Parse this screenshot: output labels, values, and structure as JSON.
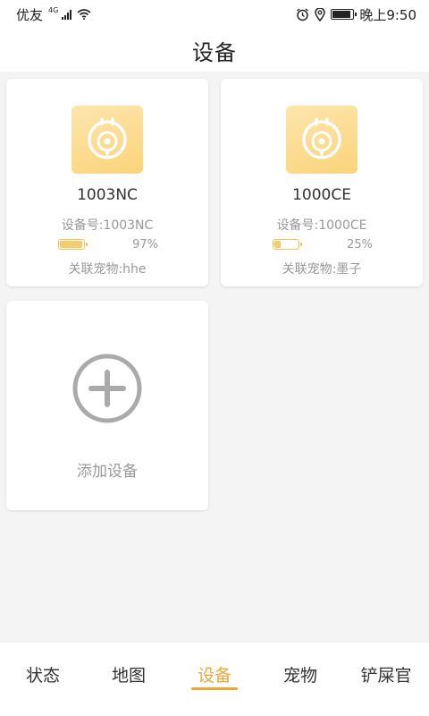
{
  "status_bar": {
    "carrier": "优友",
    "network": "4G",
    "time": "晚上9:50",
    "battery_level": 0.9
  },
  "header": {
    "title": "设备"
  },
  "devices": [
    {
      "name": "1003NC",
      "id_text": "设备号:1003NC",
      "battery_text": "97%",
      "battery_level": 0.97,
      "pet_text": "关联宠物:hhe",
      "icon": "pet-tracker-icon"
    },
    {
      "name": "1000CE",
      "id_text": "设备号:1000CE",
      "battery_text": "25%",
      "battery_level": 0.25,
      "pet_text": "关联宠物:墨子",
      "icon": "pet-tracker-icon"
    }
  ],
  "add_device": {
    "label": "添加设备",
    "icon": "plus-circle-icon"
  },
  "nav": {
    "active_index": 2,
    "items": [
      {
        "label": "状态"
      },
      {
        "label": "地图"
      },
      {
        "label": "设备"
      },
      {
        "label": "宠物"
      },
      {
        "label": "铲屎官"
      }
    ]
  },
  "colors": {
    "accent": "#efa634",
    "icon_gradient_start": "#fde6ad",
    "icon_gradient_end": "#fbd37a",
    "battery_fill": "#f5cc6c"
  }
}
